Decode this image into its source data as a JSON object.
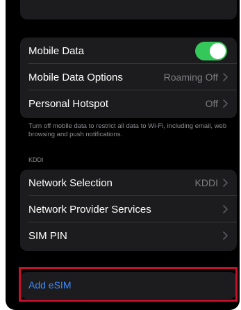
{
  "colors": {
    "background": "#000000",
    "group_background": "#1c1c1e",
    "toggle_on": "#34c759",
    "link_blue": "#3d8bff",
    "highlight_border": "#c8102e"
  },
  "data_group": {
    "mobile_data": {
      "label": "Mobile Data",
      "toggle_state": "on"
    },
    "mobile_data_options": {
      "label": "Mobile Data Options",
      "value": "Roaming Off"
    },
    "personal_hotspot": {
      "label": "Personal Hotspot",
      "value": "Off"
    }
  },
  "footnote": "Turn off mobile data to restrict all data to Wi-Fi, including email, web browsing and push notifications.",
  "carrier_section": {
    "header": "KDDI",
    "network_selection": {
      "label": "Network Selection",
      "value": "KDDI"
    },
    "network_provider_services": {
      "label": "Network Provider Services"
    },
    "sim_pin": {
      "label": "SIM PIN"
    }
  },
  "esim": {
    "label": "Add eSIM"
  },
  "icons": {
    "chevron": "chevron-right-icon"
  }
}
